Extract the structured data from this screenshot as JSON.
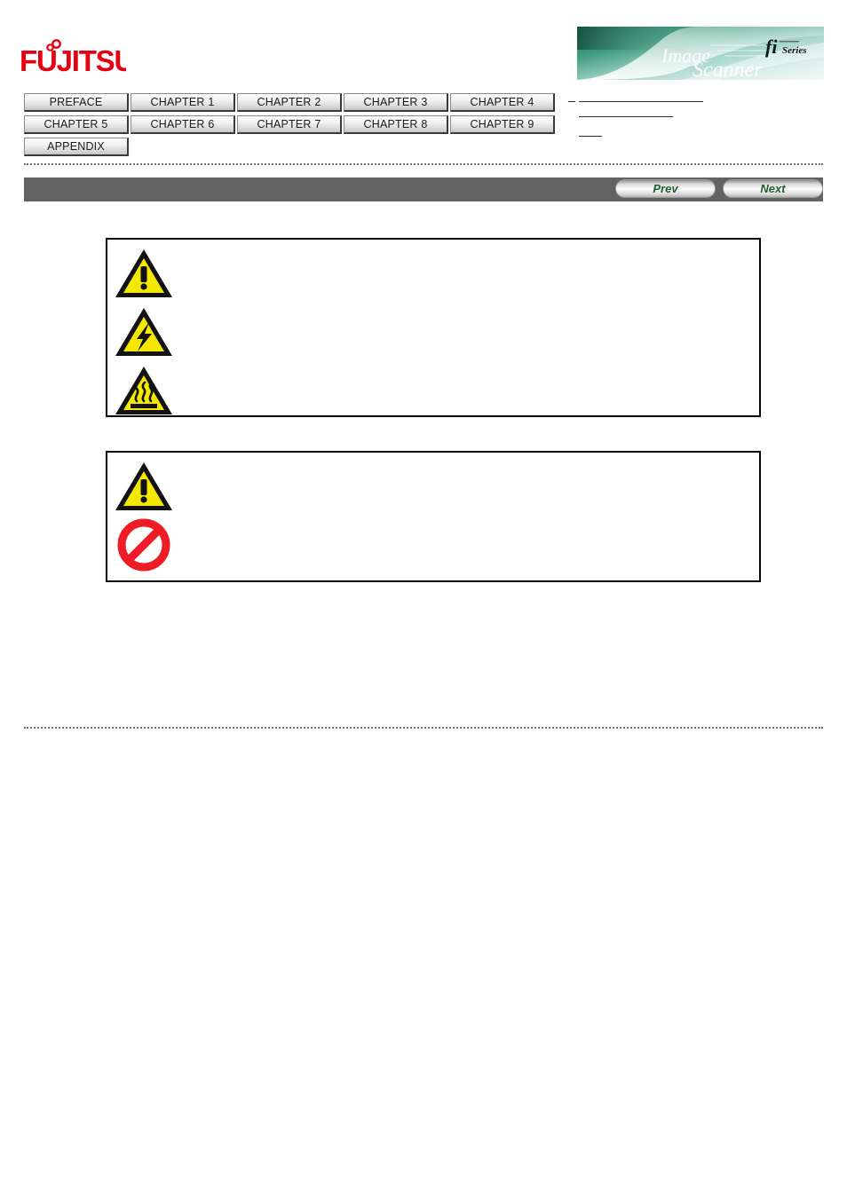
{
  "header": {
    "logo_text": "FUJITSU",
    "logo_color": "#e60012",
    "banner": {
      "product_line": "fi",
      "series_label": "Series",
      "tagline_top": "Image",
      "tagline_bottom": "Scanner",
      "gradient_from": "#1f7a5e",
      "gradient_to": "#eaf4f2"
    }
  },
  "nav_tabs": {
    "row1": [
      {
        "label": "PREFACE",
        "name": "tab-preface"
      },
      {
        "label": "CHAPTER 1",
        "name": "tab-chapter-1"
      },
      {
        "label": "CHAPTER 2",
        "name": "tab-chapter-2"
      },
      {
        "label": "CHAPTER 3",
        "name": "tab-chapter-3"
      },
      {
        "label": "CHAPTER 4",
        "name": "tab-chapter-4"
      }
    ],
    "row2": [
      {
        "label": "CHAPTER 5",
        "name": "tab-chapter-5"
      },
      {
        "label": "CHAPTER 6",
        "name": "tab-chapter-6"
      },
      {
        "label": "CHAPTER 7",
        "name": "tab-chapter-7"
      },
      {
        "label": "CHAPTER 8",
        "name": "tab-chapter-8"
      },
      {
        "label": "CHAPTER 9",
        "name": "tab-chapter-9"
      }
    ],
    "row3": [
      {
        "label": "APPENDIX",
        "name": "tab-appendix"
      }
    ]
  },
  "toolbar": {
    "prev_label": "Prev",
    "next_label": "Next",
    "bar_color": "#636363",
    "button_text_color": "#1f5c2e"
  },
  "warning_boxes": [
    {
      "name": "warning-box",
      "icons": [
        {
          "name": "warning-triangle-icon",
          "type": "warning-exclamation"
        },
        {
          "name": "electric-shock-icon",
          "type": "electric-shock"
        },
        {
          "name": "hot-surface-icon",
          "type": "hot-surface"
        }
      ],
      "text": ""
    },
    {
      "name": "caution-box",
      "icons": [
        {
          "name": "caution-triangle-icon",
          "type": "warning-exclamation"
        },
        {
          "name": "prohibition-icon",
          "type": "prohibition"
        }
      ],
      "text": ""
    }
  ],
  "colors": {
    "warning_yellow": "#f5e800",
    "warning_outline": "#121212",
    "prohibition_red": "#ee1c24",
    "separator": "#6b6b7a"
  }
}
